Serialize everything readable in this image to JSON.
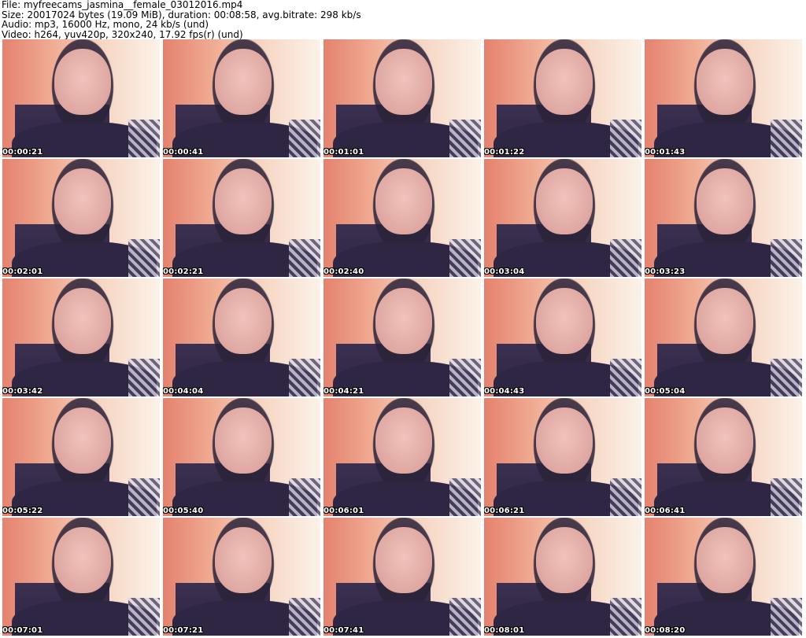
{
  "header": {
    "file_line": "File: myfreecams_jasmina__female_03012016.mp4",
    "size_line": "Size: 20017024 bytes (19.09 MiB), duration: 00:08:58, avg.bitrate: 298 kb/s",
    "audio_line": "Audio: mp3, 16000 Hz, mono, 24 kb/s (und)",
    "video_line": "Video: h264, yuv420p, 320x240, 17.92 fps(r) (und)"
  },
  "thumbnails": [
    {
      "timestamp": "00:00:21"
    },
    {
      "timestamp": "00:00:41"
    },
    {
      "timestamp": "00:01:01"
    },
    {
      "timestamp": "00:01:22"
    },
    {
      "timestamp": "00:01:43"
    },
    {
      "timestamp": "00:02:01"
    },
    {
      "timestamp": "00:02:21"
    },
    {
      "timestamp": "00:02:40"
    },
    {
      "timestamp": "00:03:04"
    },
    {
      "timestamp": "00:03:23"
    },
    {
      "timestamp": "00:03:42"
    },
    {
      "timestamp": "00:04:04"
    },
    {
      "timestamp": "00:04:21"
    },
    {
      "timestamp": "00:04:43"
    },
    {
      "timestamp": "00:05:04"
    },
    {
      "timestamp": "00:05:22"
    },
    {
      "timestamp": "00:05:40"
    },
    {
      "timestamp": "00:06:01"
    },
    {
      "timestamp": "00:06:21"
    },
    {
      "timestamp": "00:06:41"
    },
    {
      "timestamp": "00:07:01"
    },
    {
      "timestamp": "00:07:21"
    },
    {
      "timestamp": "00:07:41"
    },
    {
      "timestamp": "00:08:01"
    },
    {
      "timestamp": "00:08:20"
    }
  ]
}
